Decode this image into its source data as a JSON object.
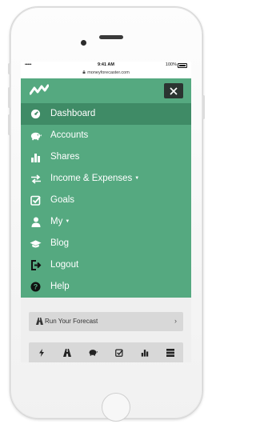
{
  "status_bar": {
    "carrier": "••••• ",
    "time": "9:41 AM",
    "battery": "100%"
  },
  "browser": {
    "url": "moneyforecaster.com"
  },
  "menu": {
    "items": [
      {
        "label": "Dashboard",
        "icon": "dashboard-icon",
        "active": true
      },
      {
        "label": "Accounts",
        "icon": "piggy-bank-icon"
      },
      {
        "label": "Shares",
        "icon": "bar-chart-icon"
      },
      {
        "label": "Income & Expenses",
        "icon": "exchange-icon",
        "dropdown": true
      },
      {
        "label": "Goals",
        "icon": "check-square-icon"
      },
      {
        "label": "My",
        "icon": "user-icon",
        "dropdown": true
      },
      {
        "label": "Blog",
        "icon": "graduation-cap-icon"
      },
      {
        "label": "Logout",
        "icon": "logout-icon"
      },
      {
        "label": "Help",
        "icon": "help-icon"
      }
    ]
  },
  "forecast": {
    "label": "Run Your Forecast"
  },
  "toolbar": {
    "icons": [
      "bolt-icon",
      "road-icon",
      "piggy-bank-icon",
      "check-square-icon",
      "bar-chart-icon",
      "server-icon"
    ]
  },
  "colors": {
    "menu_bg": "#55a980",
    "active_bg": "#3f8b66",
    "close_bg": "#2b3431",
    "content_bg": "#efefef",
    "button_bg": "#d8d8d8"
  }
}
